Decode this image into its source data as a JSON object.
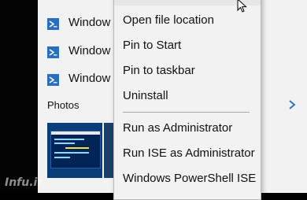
{
  "start_menu": {
    "apps": [
      {
        "label": "Window",
        "icon": "powershell-icon"
      },
      {
        "label": "Window",
        "icon": "powershell-icon"
      },
      {
        "label": "Window",
        "icon": "powershell-icon"
      }
    ],
    "section_title": "Photos"
  },
  "context_menu": {
    "items": [
      {
        "label": "Open file location"
      },
      {
        "label": "Pin to Start"
      },
      {
        "label": "Pin to taskbar"
      },
      {
        "label": "Uninstall"
      },
      {
        "label": "Run as Administrator"
      },
      {
        "label": "Run ISE as Administrator"
      },
      {
        "label": "Windows PowerShell ISE"
      }
    ]
  },
  "watermark": "Infu.ir",
  "colors": {
    "panel_bg": "#f2f2f2",
    "menu_bg": "#f2f2f2",
    "powershell_blue": "#2a6fbf",
    "accent": "#1f6fc5",
    "taskbar": "#040404"
  }
}
